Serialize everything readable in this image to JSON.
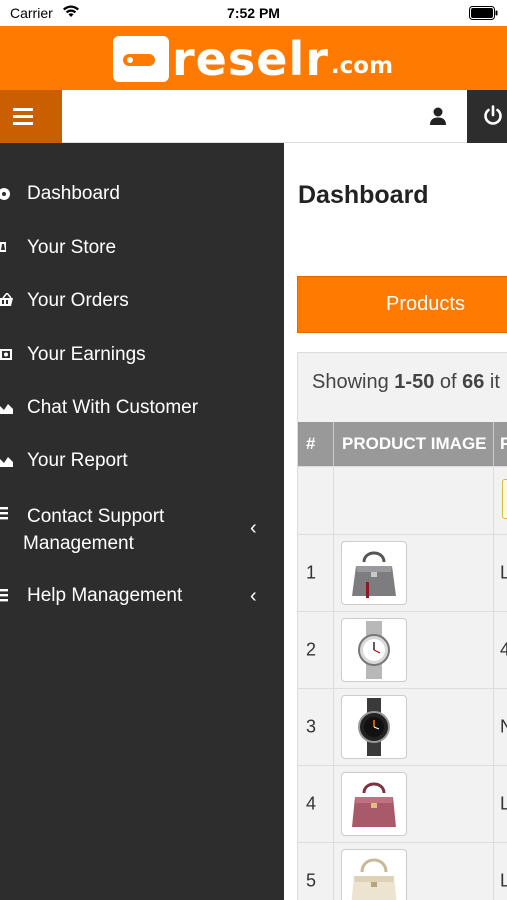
{
  "status_bar": {
    "carrier": "Carrier",
    "time": "7:52 PM"
  },
  "brand": {
    "logo_text": "reselr",
    "logo_tld": ".com",
    "color": "#ff7a00"
  },
  "nav": {
    "menu_icon": "hamburger-icon",
    "user_icon": "user-icon",
    "power_icon": "power-icon"
  },
  "sidebar": {
    "items": [
      {
        "label": "Dashboard",
        "icon": "dashboard-icon"
      },
      {
        "label": "Your Store",
        "icon": "store-icon"
      },
      {
        "label": "Your Orders",
        "icon": "basket-icon"
      },
      {
        "label": "Your Earnings",
        "icon": "money-icon"
      },
      {
        "label": "Chat With Customer",
        "icon": "chart-icon"
      },
      {
        "label": "Your Report",
        "icon": "chart-icon"
      },
      {
        "label": "Contact Support Management",
        "icon": "list-icon",
        "chevron": "‹"
      },
      {
        "label": "Help Management",
        "icon": "list-icon",
        "chevron": "‹"
      }
    ]
  },
  "main": {
    "title": "Dashboard",
    "tab_label": "Products",
    "showing_prefix": "Showing ",
    "showing_range": "1-50",
    "showing_of": " of ",
    "showing_total": "66",
    "showing_suffix": " it",
    "columns": [
      "#",
      "PRODUCT IMAGE",
      "P"
    ],
    "rows": [
      {
        "num": "1",
        "next": "L",
        "image": "handbag-gray"
      },
      {
        "num": "2",
        "next": "4",
        "image": "watch-silver"
      },
      {
        "num": "3",
        "next": "N",
        "image": "watch-black"
      },
      {
        "num": "4",
        "next": "L",
        "image": "handbag-pink"
      },
      {
        "num": "5",
        "next": "L",
        "image": "handbag-white"
      }
    ]
  }
}
